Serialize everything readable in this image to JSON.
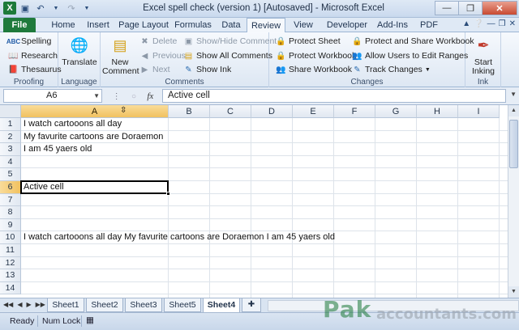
{
  "window": {
    "title": "Excel spell check (version 1) [Autosaved]  -  Microsoft Excel"
  },
  "tabs": [
    "File",
    "Home",
    "Insert",
    "Page Layout",
    "Formulas",
    "Data",
    "Review",
    "View",
    "Developer",
    "Add-Ins",
    "PDF"
  ],
  "active_tab": "Review",
  "ribbon": {
    "proofing": {
      "label": "Proofing",
      "spelling": "Spelling",
      "research": "Research",
      "thesaurus": "Thesaurus"
    },
    "language": {
      "label": "Language",
      "translate": "Translate"
    },
    "comments": {
      "label": "Comments",
      "new_comment_1": "New",
      "new_comment_2": "Comment",
      "delete": "Delete",
      "previous": "Previous",
      "next": "Next",
      "show_hide": "Show/Hide Comment",
      "show_all": "Show All Comments",
      "show_ink": "Show Ink"
    },
    "changes": {
      "label": "Changes",
      "protect_sheet": "Protect Sheet",
      "protect_workbook": "Protect Workbook",
      "share_workbook": "Share Workbook",
      "protect_share": "Protect and Share Workbook",
      "allow_users": "Allow Users to Edit Ranges",
      "track_changes": "Track Changes"
    },
    "ink": {
      "label": "Ink",
      "start_1": "Start",
      "start_2": "Inking"
    }
  },
  "formula_bar": {
    "name_box": "A6",
    "fx": "fx",
    "content": "Active cell"
  },
  "columns": [
    "A",
    "B",
    "C",
    "D",
    "E",
    "F",
    "G",
    "H",
    "I"
  ],
  "rows": [
    "1",
    "2",
    "3",
    "4",
    "5",
    "6",
    "7",
    "8",
    "9",
    "10",
    "11",
    "12",
    "13",
    "14"
  ],
  "cells": {
    "A1": "I watch cartooons all day",
    "A2": "My favurite cartoons are Doraemon",
    "A3": "I am 45 yaers old",
    "A6": "Active cell",
    "A10": "I watch cartooons all day My favurite cartoons are Doraemon I am 45 yaers old"
  },
  "sheets": [
    "Sheet1",
    "Sheet2",
    "Sheet3",
    "Sheet5",
    "Sheet4"
  ],
  "active_sheet": "Sheet4",
  "status": {
    "ready": "Ready",
    "numlock": "Num Lock"
  },
  "watermark": {
    "pak": "Pak",
    "accountants": "accountants.com"
  }
}
